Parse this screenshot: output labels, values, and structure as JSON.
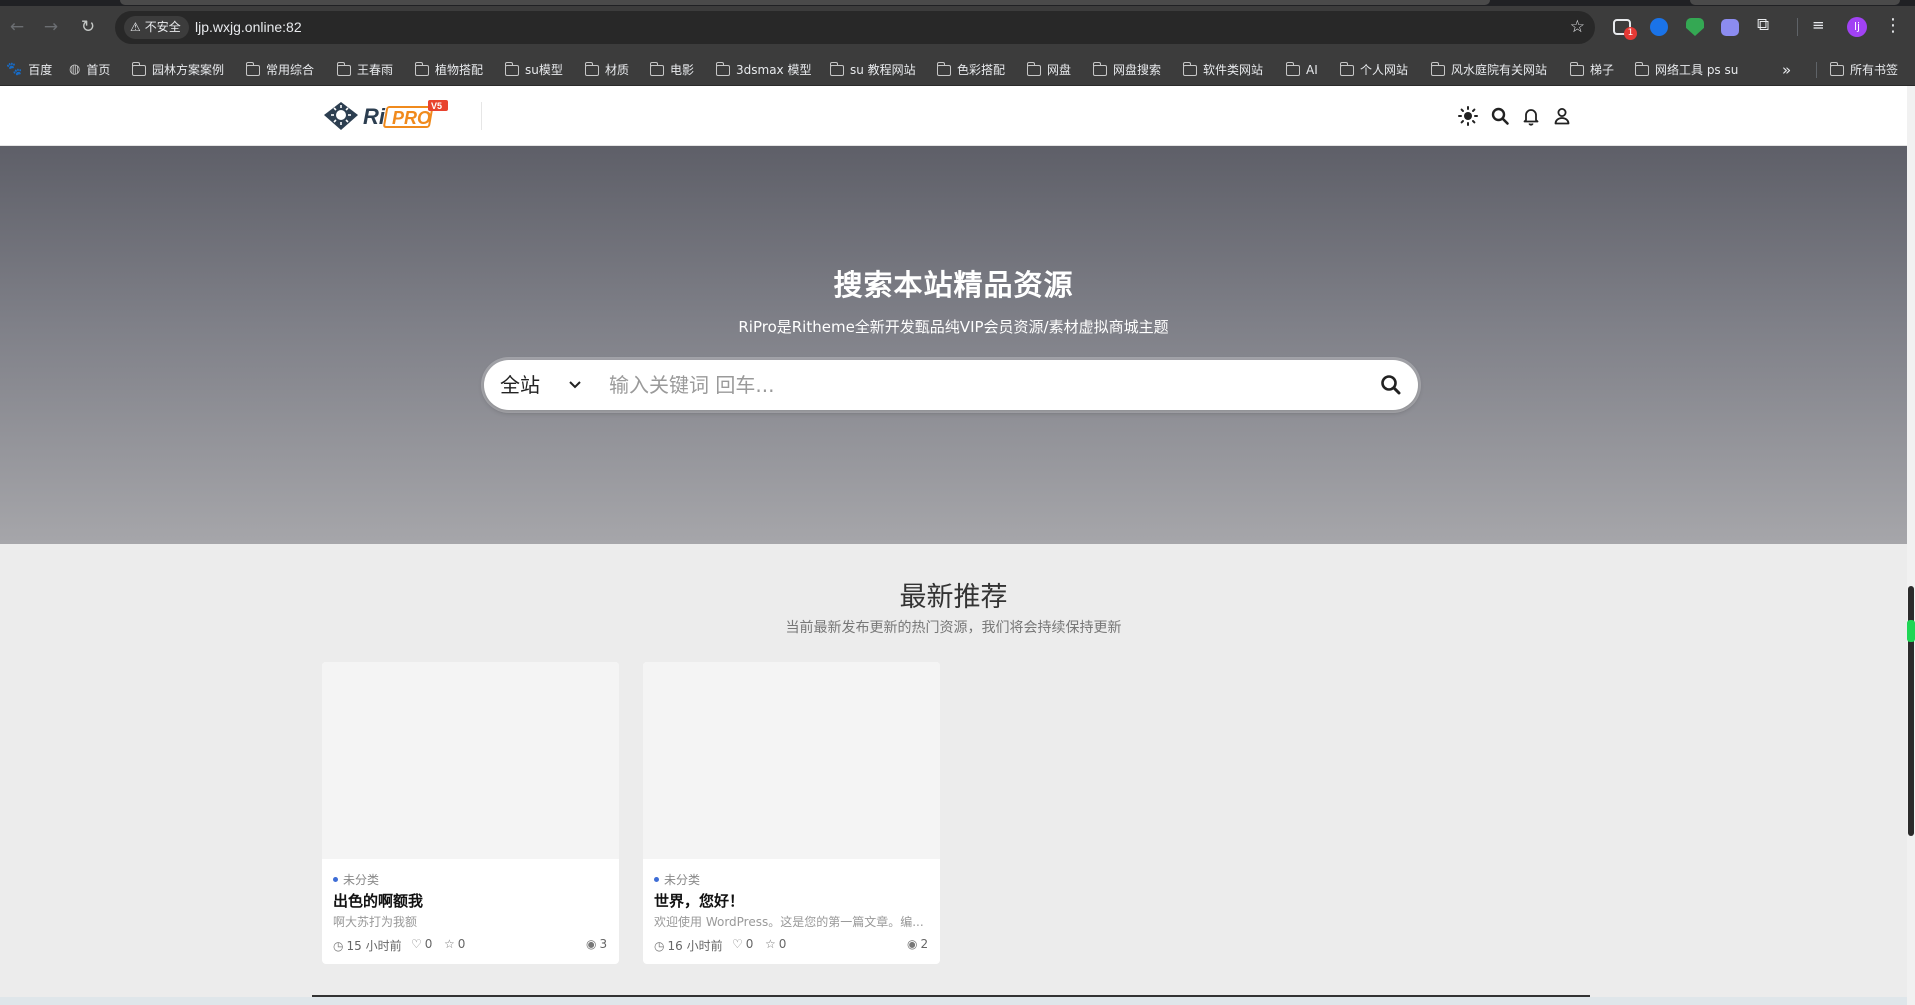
{
  "browser": {
    "security_label": "不安全",
    "url": "ljp.wxjg.online:82",
    "profile_initial": "lj",
    "extension_badge": "1",
    "icons": {
      "back": "arrow-left-icon",
      "forward": "arrow-right-icon",
      "reload": "reload-icon",
      "bookmark_star": "star-icon",
      "menu": "vertical-dots-icon"
    }
  },
  "bookmarks": {
    "items": [
      {
        "label": "百度",
        "icon": "baidu-icon"
      },
      {
        "label": "首页",
        "icon": "globe-icon"
      },
      {
        "label": "园林方案案例",
        "icon": "folder-icon"
      },
      {
        "label": "常用综合",
        "icon": "folder-icon"
      },
      {
        "label": "王春雨",
        "icon": "folder-icon"
      },
      {
        "label": "植物搭配",
        "icon": "folder-icon"
      },
      {
        "label": "su模型",
        "icon": "folder-icon"
      },
      {
        "label": "材质",
        "icon": "folder-icon"
      },
      {
        "label": "电影",
        "icon": "folder-icon"
      },
      {
        "label": "3dsmax 模型",
        "icon": "folder-icon"
      },
      {
        "label": "su 教程网站",
        "icon": "folder-icon"
      },
      {
        "label": "色彩搭配",
        "icon": "folder-icon"
      },
      {
        "label": "网盘",
        "icon": "folder-icon"
      },
      {
        "label": "网盘搜索",
        "icon": "folder-icon"
      },
      {
        "label": "软件类网站",
        "icon": "folder-icon"
      },
      {
        "label": "AI",
        "icon": "folder-icon"
      },
      {
        "label": "个人网站",
        "icon": "folder-icon"
      },
      {
        "label": "风水庭院有关网站",
        "icon": "folder-icon"
      },
      {
        "label": "梯子",
        "icon": "folder-icon"
      },
      {
        "label": "网络工具 ps su",
        "icon": "folder-icon"
      }
    ],
    "more": "»",
    "all_bookmarks": "所有书签"
  },
  "site": {
    "logo_text_ri": "Ri",
    "logo_text_pro": "PRO",
    "logo_version": "V5",
    "header_icons": [
      "theme-toggle-icon",
      "search-icon",
      "bell-icon",
      "user-icon"
    ]
  },
  "hero": {
    "title": "搜索本站精品资源",
    "subtitle": "RiPro是Ritheme全新开发甄品纯VIP会员资源/素材虚拟商城主题",
    "search_scope": "全站",
    "search_placeholder": "输入关键词 回车..."
  },
  "section": {
    "title": "最新推荐",
    "subtitle": "当前最新发布更新的热门资源，我们将会持续保持更新"
  },
  "cards": [
    {
      "category": "未分类",
      "title": "出色的啊额我",
      "excerpt": "啊大苏打为我额",
      "time": "15 小时前",
      "likes": "0",
      "favorites": "0",
      "views": "3"
    },
    {
      "category": "未分类",
      "title": "世界，您好！",
      "excerpt": "欢迎使用 WordPress。这是您的第一篇文章。编...",
      "time": "16 小时前",
      "likes": "0",
      "favorites": "0",
      "views": "2"
    }
  ],
  "colors": {
    "accent_blue": "#3e6dd6",
    "logo_orange": "#f08a1c",
    "logo_dark": "#2c3e50"
  }
}
